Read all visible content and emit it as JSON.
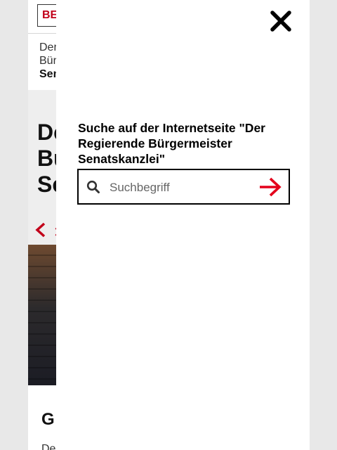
{
  "background_page": {
    "logo_text": "BE",
    "breadcrumb": [
      "Der",
      "Bür",
      "Sen"
    ],
    "heading_lines": [
      "De",
      "Bü",
      "Se"
    ],
    "section_heading": "G",
    "section_text": "De"
  },
  "search_overlay": {
    "title": "Suche auf der Internetseite \"Der Regierende Bürgermeister Senatskanzlei\"",
    "input_placeholder": "Suchbegriff",
    "input_value": "",
    "icons": {
      "close": "close-icon",
      "search": "search-icon",
      "submit": "arrow-right-icon"
    }
  },
  "colors": {
    "accent_red": "#e4001b",
    "text_dark": "#000000",
    "backdrop": "#e8e8e8"
  }
}
